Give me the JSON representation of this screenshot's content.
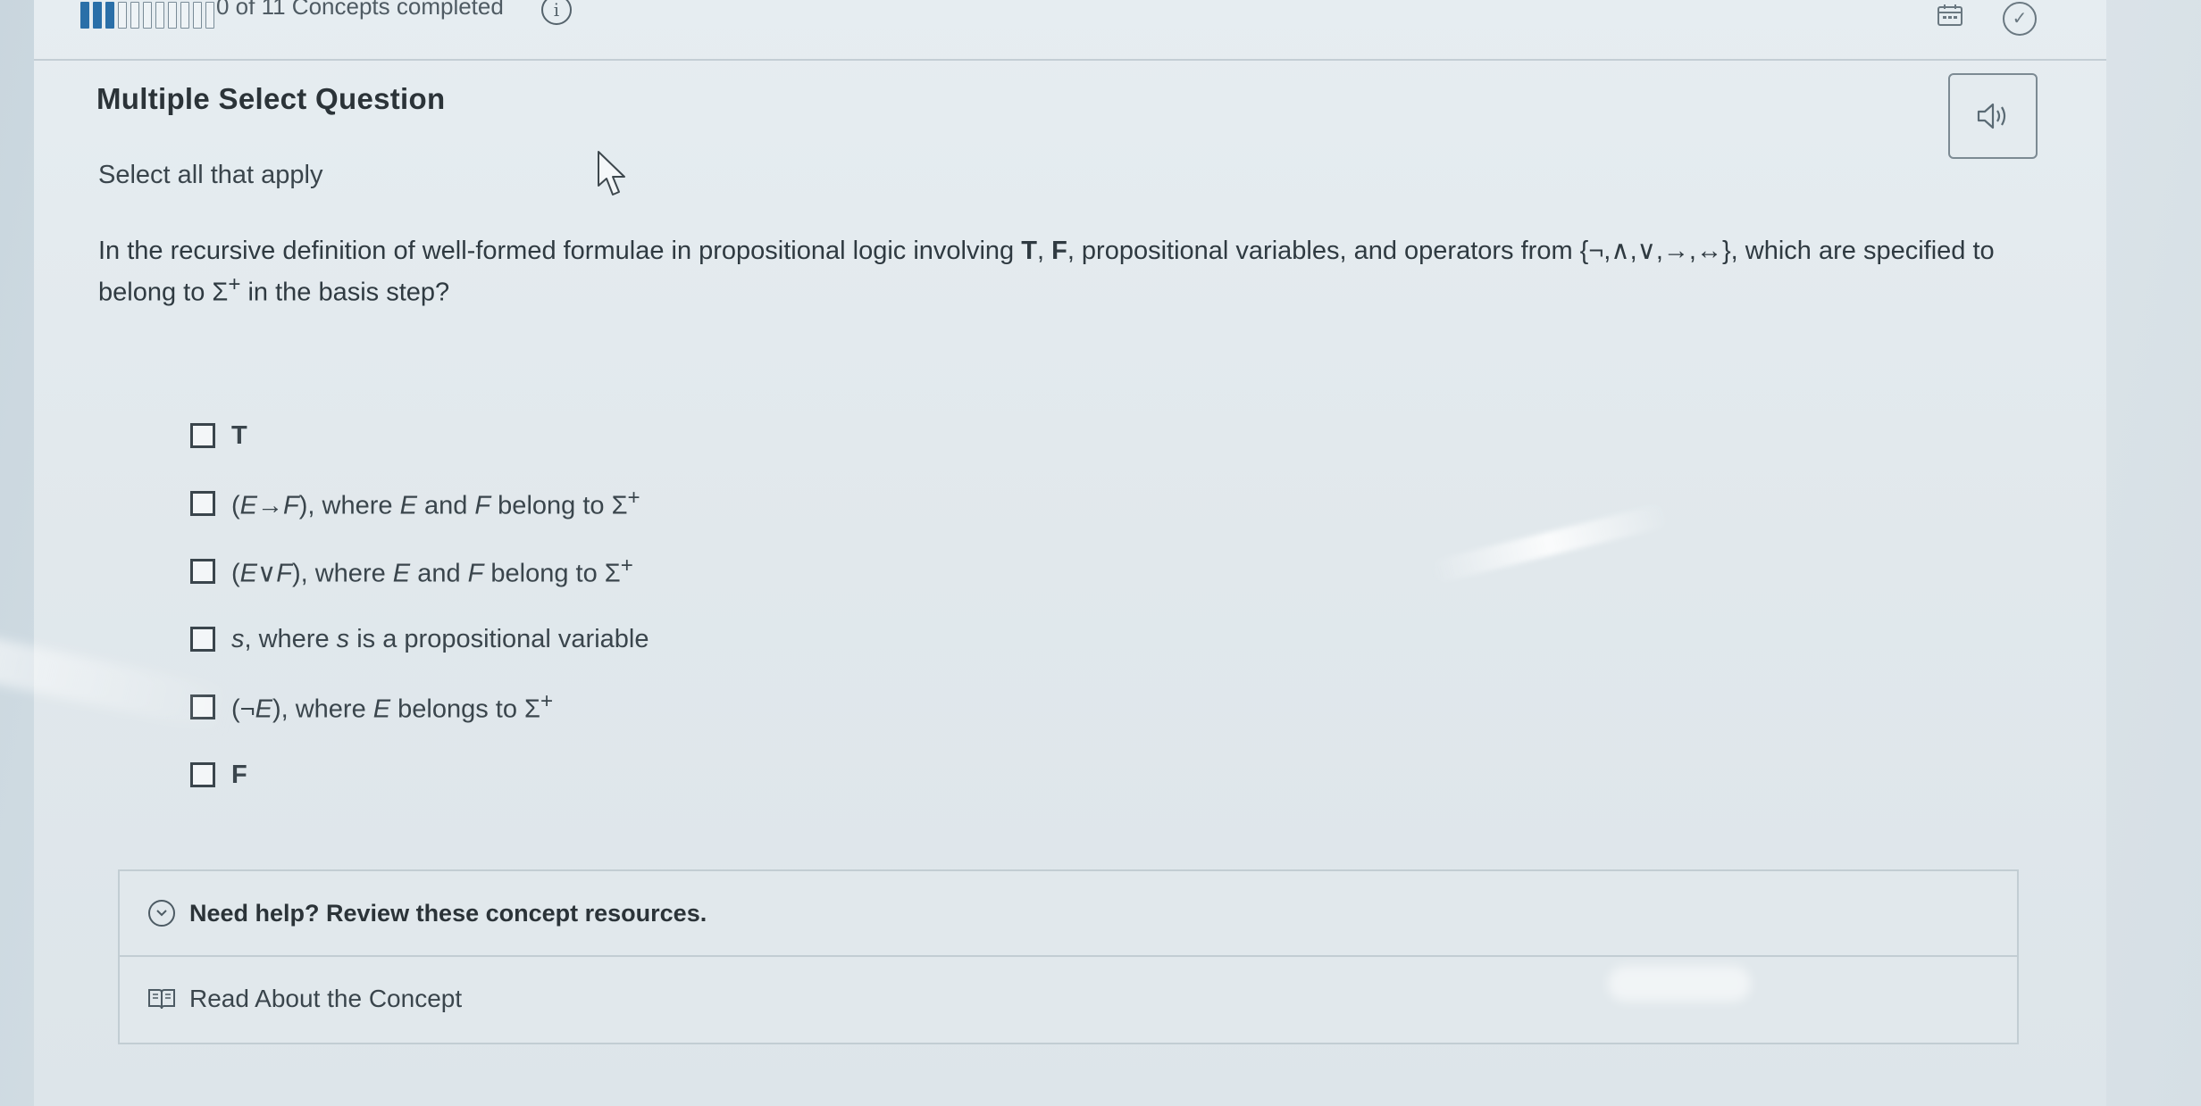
{
  "progress": {
    "segments_total": 11,
    "segments_done": 3,
    "status_text": "0 of 11 Concepts completed"
  },
  "question": {
    "title": "Multiple Select Question",
    "instruction": "Select all that apply",
    "prompt_part1": "In the recursive definition of well-formed formulae in propositional logic involving ",
    "prompt_T": "T",
    "prompt_sep1": ", ",
    "prompt_F": "F",
    "prompt_part2": ", propositional variables, and operators from {¬,∧,∨,→,↔}, which are specified to belong to Σ",
    "prompt_sup": "+",
    "prompt_part3": " in the basis step?"
  },
  "options": [
    {
      "text": "T",
      "bold": true
    },
    {
      "pre": "(",
      "var1": "E",
      "op": "→",
      "var2": "F",
      "post": "), where ",
      "v1": "E",
      "mid": " and ",
      "v2": "F",
      "tail": " belong to Σ",
      "sup": "+"
    },
    {
      "pre": "(",
      "var1": "E",
      "op": "∨",
      "var2": "F",
      "post": "), where ",
      "v1": "E",
      "mid": " and ",
      "v2": "F",
      "tail": " belong to Σ",
      "sup": "+"
    },
    {
      "v": "s",
      "text": ", where ",
      "v2": "s",
      "tail": " is a propositional variable"
    },
    {
      "pre": "(¬",
      "var1": "E",
      "post": "), where ",
      "v1": "E",
      "tail": " belongs to Σ",
      "sup": "+"
    },
    {
      "text": "F",
      "bold": true
    }
  ],
  "help": {
    "title": "Need help? Review these concept resources.",
    "link": "Read About the Concept"
  },
  "icons": {
    "info": "info-icon",
    "calendar": "calendar-icon",
    "check": "check-circle-icon",
    "audio": "speaker-icon",
    "help_toggle": "chevron-down-circle-icon",
    "book": "book-icon"
  },
  "colors": {
    "progress_done": "#2a6fa8",
    "text": "#2b3338",
    "border": "#c2cdd3"
  }
}
